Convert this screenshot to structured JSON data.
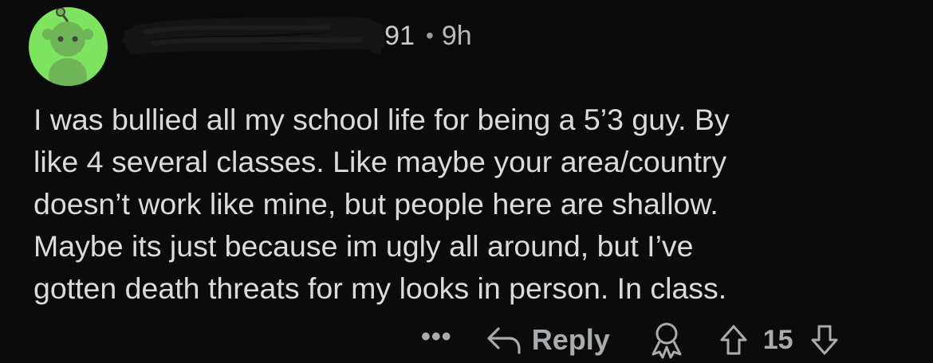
{
  "comment": {
    "username_visible_fragment": "91",
    "separator": "•",
    "age": "9h",
    "text": "I was bullied all my school life for being a 5’3 guy. By\nlike 4 several classes. Like maybe your area/country\ndoesn’t work like mine, but people here are shallow.\nMaybe its just because im ugly all around, but I’ve\ngotten death threats for my looks in person. In class.",
    "more_label": "•••",
    "reply_label": "Reply",
    "vote_count": "15"
  },
  "colors": {
    "background": "#0b0b0b",
    "avatar_bg": "#7ee35f",
    "text": "#d9dbdd",
    "muted": "#a9acae"
  },
  "icons": {
    "avatar": "snoo-avatar-icon",
    "reply": "reply-arrow-icon",
    "award": "award-icon",
    "upvote": "upvote-arrow-icon",
    "downvote": "downvote-arrow-icon"
  }
}
